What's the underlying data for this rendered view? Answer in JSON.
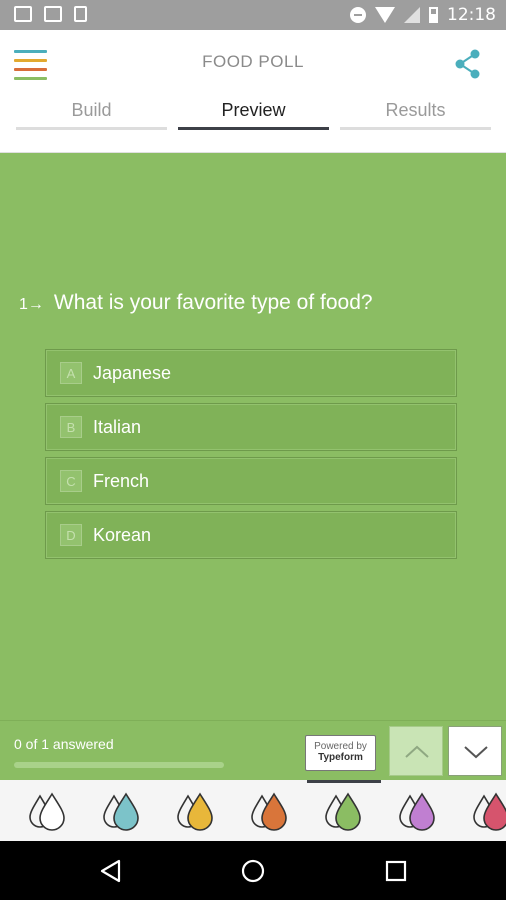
{
  "status_bar": {
    "time": "12:18",
    "icons": [
      "image-icon",
      "gmail-icon",
      "download-icon",
      "do-not-disturb-icon",
      "wifi-icon",
      "signal-icon",
      "battery-icon"
    ]
  },
  "app_bar": {
    "title": "FOOD POLL",
    "menu_icon": "hamburger-menu-icon",
    "share_icon": "share-icon",
    "menu_colors": [
      "#4aaebc",
      "#e2a92f",
      "#d96d3a",
      "#8bbd63"
    ]
  },
  "tabs": [
    {
      "label": "Build",
      "active": false
    },
    {
      "label": "Preview",
      "active": true
    },
    {
      "label": "Results",
      "active": false
    }
  ],
  "form": {
    "background": "#8bbd63",
    "question_number": "1",
    "question_text": "What is your favorite type of food?",
    "choices": [
      {
        "key": "A",
        "label": "Japanese"
      },
      {
        "key": "B",
        "label": "Italian"
      },
      {
        "key": "C",
        "label": "French"
      },
      {
        "key": "D",
        "label": "Korean"
      }
    ]
  },
  "footer": {
    "progress_text": "0 of 1 answered",
    "progress_fraction": 0,
    "powered_line1": "Powered by",
    "powered_line2": "Typeform",
    "up_icon": "chevron-up-icon",
    "down_icon": "chevron-down-icon"
  },
  "themes": [
    {
      "name": "theme-white",
      "color": "#ffffff"
    },
    {
      "name": "theme-teal",
      "color": "#7cc3c9"
    },
    {
      "name": "theme-yellow",
      "color": "#e8b73a"
    },
    {
      "name": "theme-orange",
      "color": "#d9753a"
    },
    {
      "name": "theme-green",
      "color": "#8bbd63",
      "selected": true
    },
    {
      "name": "theme-purple",
      "color": "#c07fd1"
    },
    {
      "name": "theme-red",
      "color": "#d6546d"
    }
  ],
  "nav_bar": {
    "back_icon": "back-triangle-icon",
    "home_icon": "home-circle-icon",
    "recents_icon": "recents-square-icon"
  }
}
